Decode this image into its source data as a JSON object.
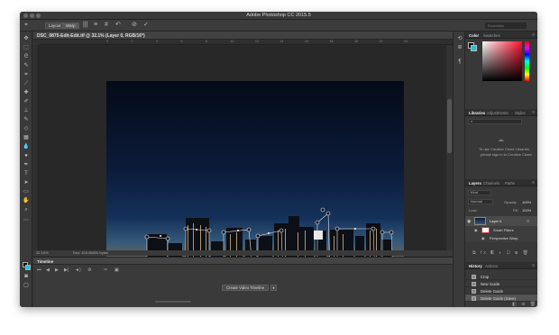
{
  "window": {
    "title": "Adobe Photoshop CC 2015.5"
  },
  "options_bar": {
    "layout_label": "Layout",
    "warp_label": "Warp",
    "cancel_icon": "cancel-icon",
    "commit_icon": "commit-check-icon",
    "search_placeholder": "Essentials"
  },
  "document": {
    "tab_label": "DSC_0875-Edit-Edit.tif @ 32.1% (Layer 0, RGB/16*)",
    "zoom": "32.15%",
    "doc_size": "Doc: 100.0M/00 bytes",
    "ruler_numbers": [
      "0",
      "2",
      "4",
      "6",
      "8",
      "10",
      "12",
      "14",
      "16",
      "18",
      "20",
      "22",
      "24"
    ]
  },
  "timeline": {
    "title": "Timeline",
    "create_button": "Create Video Timeline",
    "create_dropdown_arrow": "▾"
  },
  "color_panel": {
    "tabs": [
      "Color",
      "Swatches"
    ],
    "foreground": "#0a0a0a",
    "background": "#1ac6d8"
  },
  "libraries_panel": {
    "tabs": [
      "Libraries",
      "Adjustments",
      "Styles"
    ],
    "message_line1": "To use Creative Cloud Libraries,",
    "message_line2": "please sign in to Creative Cloud."
  },
  "layers_panel": {
    "tabs": [
      "Layers",
      "Channels",
      "Paths"
    ],
    "filter_label": "Kind",
    "blend_mode": "Normal",
    "opacity_label": "Opacity:",
    "opacity_value": "100%",
    "lock_label": "Lock:",
    "fill_label": "Fill:",
    "fill_value": "100%",
    "layers": [
      {
        "name": "Layer 0"
      },
      {
        "name": "Smart Filters"
      },
      {
        "name": "Perspective Warp"
      }
    ]
  },
  "history_panel": {
    "tabs": [
      "History",
      "Actions"
    ],
    "items": [
      "Crop",
      "New Guide",
      "Delete Guide",
      "Delete Guide (Save)"
    ]
  }
}
